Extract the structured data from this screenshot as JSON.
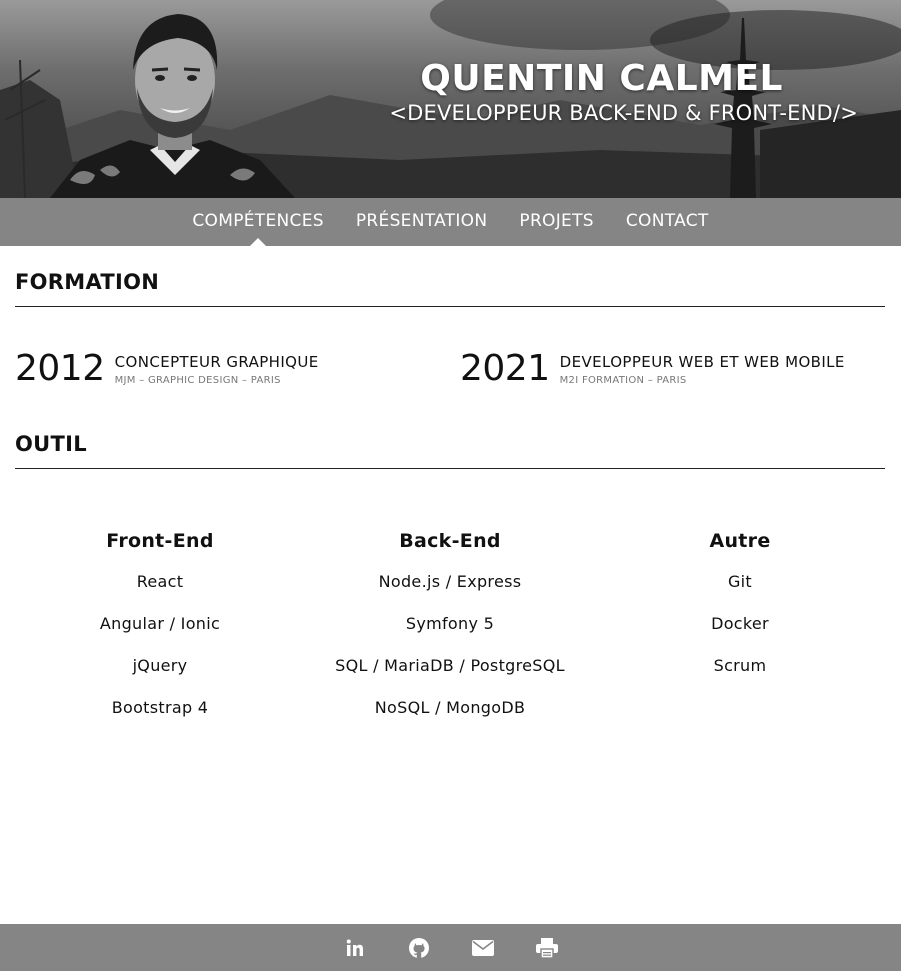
{
  "header": {
    "name": "QUENTIN CALMEL",
    "role": "<DEVELOPPEUR BACK-END & FRONT-END/>"
  },
  "nav": {
    "items": [
      {
        "label": "COMPÉTENCES",
        "active": true
      },
      {
        "label": "PRÉSENTATION",
        "active": false
      },
      {
        "label": "PROJETS",
        "active": false
      },
      {
        "label": "CONTACT",
        "active": false
      }
    ]
  },
  "formation": {
    "title": "FORMATION",
    "items": [
      {
        "year": "2012",
        "title": "CONCEPTEUR GRAPHIQUE",
        "sub": "MJM – GRAPHIC DESIGN – PARIS"
      },
      {
        "year": "2021",
        "title": "DEVELOPPEUR WEB ET WEB MOBILE",
        "sub": "M2I FORMATION – PARIS"
      }
    ]
  },
  "outil": {
    "title": "OUTIL",
    "columns": [
      {
        "heading": "Front-End",
        "items": [
          "React",
          "Angular / Ionic",
          "jQuery",
          "Bootstrap 4"
        ]
      },
      {
        "heading": "Back-End",
        "items": [
          "Node.js / Express",
          "Symfony 5",
          "SQL / MariaDB / PostgreSQL",
          "NoSQL / MongoDB"
        ]
      },
      {
        "heading": "Autre",
        "items": [
          "Git",
          "Docker",
          "Scrum"
        ]
      }
    ]
  },
  "footer": {
    "icons": [
      "linkedin-icon",
      "github-icon",
      "email-icon",
      "print-icon"
    ]
  },
  "colors": {
    "nav_bg": "#858585",
    "footer_bg": "#858585",
    "text": "#111111",
    "muted": "#777777"
  }
}
